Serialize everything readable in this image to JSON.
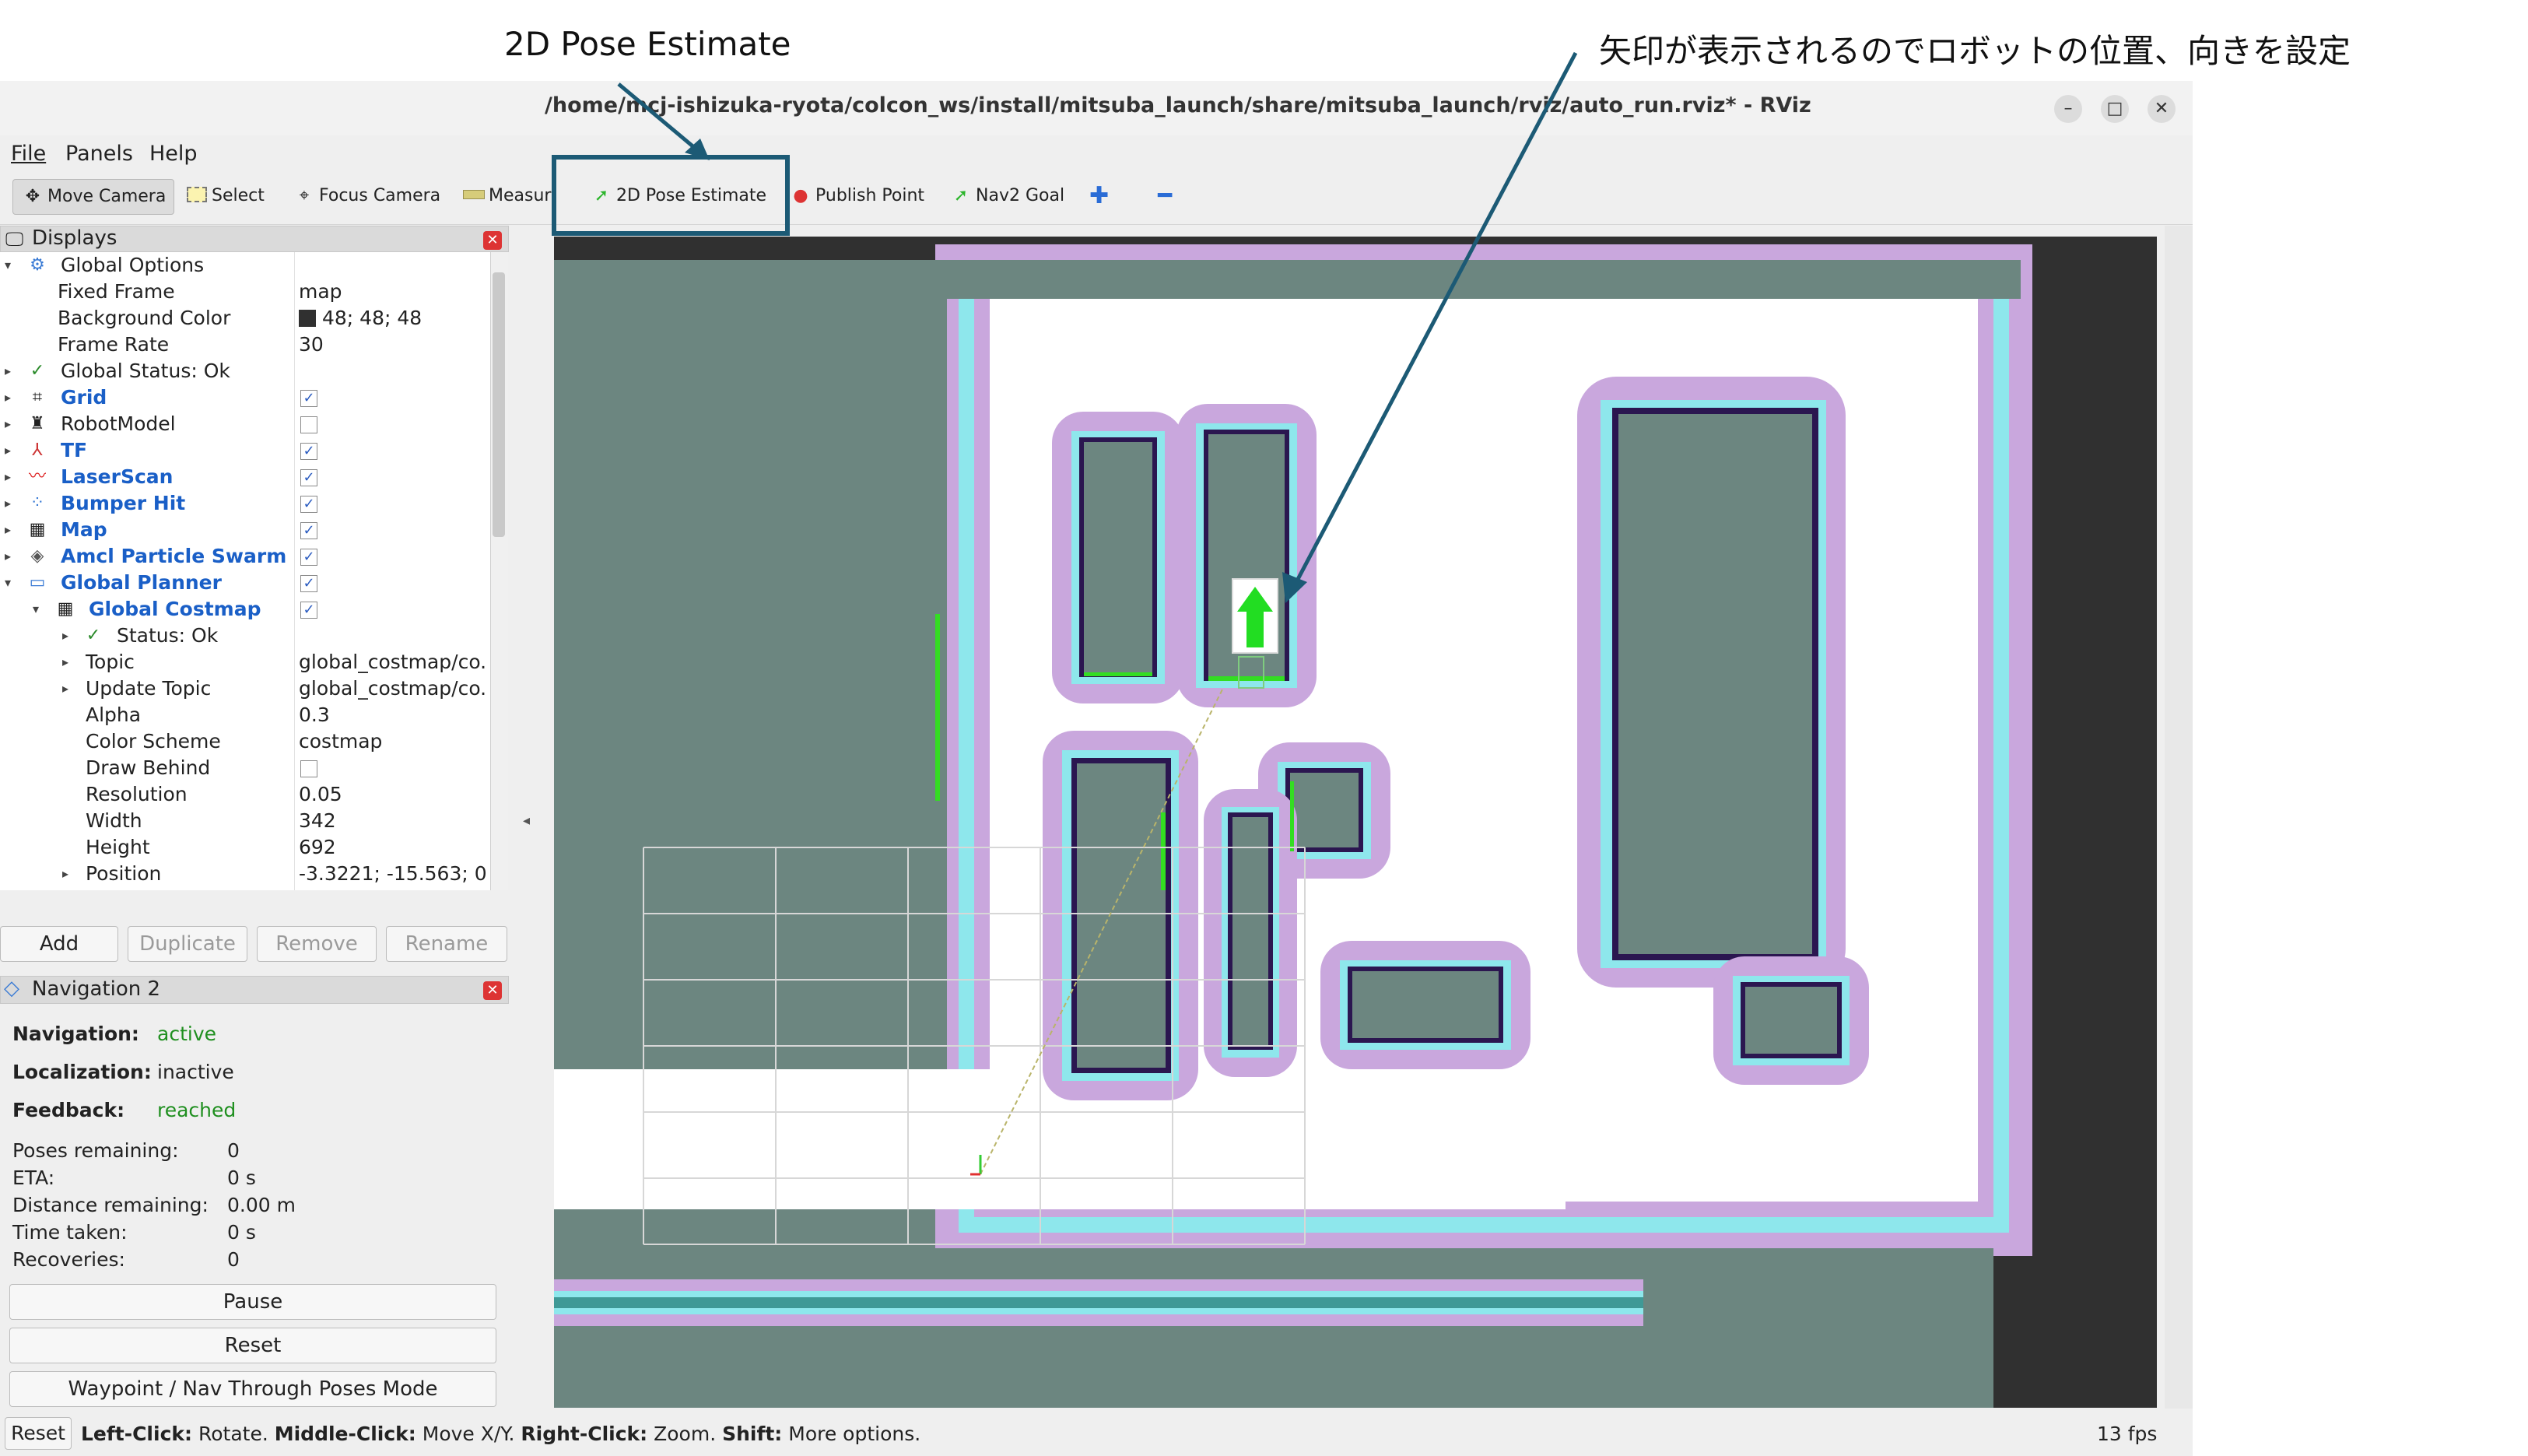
{
  "annotations": {
    "pose_label": "2D Pose Estimate",
    "arrow_note": "矢印が表示されるのでロボットの位置、向きを設定"
  },
  "window": {
    "title": "/home/mcj-ishizuka-ryota/colcon_ws/install/mitsuba_launch/share/mitsuba_launch/rviz/auto_run.rviz* - RViz",
    "controls": [
      "–",
      "□",
      "✕"
    ]
  },
  "menu": [
    "File",
    "Panels",
    "Help"
  ],
  "toolbar": {
    "move_camera": "Move Camera",
    "select": "Select",
    "focus_camera": "Focus Camera",
    "measure": "Measur",
    "pose_estimate": "2D Pose Estimate",
    "publish_point": "Publish Point",
    "nav2_goal": "Nav2 Goal",
    "icons": [
      "move-camera-icon",
      "select-icon",
      "focus-camera-icon",
      "measure-icon",
      "pose-arrow-icon",
      "pin-icon",
      "goal-arrow-icon",
      "plus-icon",
      "minus-icon"
    ]
  },
  "displays": {
    "title": "Displays",
    "rows": [
      {
        "label": "Global Options",
        "value": ""
      },
      {
        "label": "Fixed Frame",
        "value": "map"
      },
      {
        "label": "Background Color",
        "value": "48; 48; 48"
      },
      {
        "label": "Frame Rate",
        "value": "30"
      },
      {
        "label": "Global Status: Ok",
        "value": ""
      },
      {
        "label": "Grid",
        "value": "✓"
      },
      {
        "label": "RobotModel",
        "value": ""
      },
      {
        "label": "TF",
        "value": "✓"
      },
      {
        "label": "LaserScan",
        "value": "✓"
      },
      {
        "label": "Bumper Hit",
        "value": "✓"
      },
      {
        "label": "Map",
        "value": "✓"
      },
      {
        "label": "Amcl Particle Swarm",
        "value": "✓"
      },
      {
        "label": "Global Planner",
        "value": "✓"
      },
      {
        "label": "Global Costmap",
        "value": "✓"
      },
      {
        "label": "Status: Ok",
        "value": ""
      },
      {
        "label": "Topic",
        "value": "global_costmap/co."
      },
      {
        "label": "Update Topic",
        "value": "global_costmap/co."
      },
      {
        "label": "Alpha",
        "value": "0.3"
      },
      {
        "label": "Color Scheme",
        "value": "costmap"
      },
      {
        "label": "Draw Behind",
        "value": ""
      },
      {
        "label": "Resolution",
        "value": "0.05"
      },
      {
        "label": "Width",
        "value": "342"
      },
      {
        "label": "Height",
        "value": "692"
      },
      {
        "label": "Position",
        "value": "-3.3221; -15.563; 0"
      }
    ],
    "buttons": {
      "add": "Add",
      "duplicate": "Duplicate",
      "remove": "Remove",
      "rename": "Rename"
    }
  },
  "navigation": {
    "title": "Navigation 2",
    "navigation_label": "Navigation:",
    "navigation_value": "active",
    "localization_label": "Localization:",
    "localization_value": "inactive",
    "feedback_label": "Feedback:",
    "feedback_value": "reached",
    "poses_remaining_label": "Poses remaining:",
    "poses_remaining_value": "0",
    "eta_label": "ETA:",
    "eta_value": "0 s",
    "distance_label": "Distance remaining:",
    "distance_value": "0.00 m",
    "time_label": "Time taken:",
    "time_value": "0 s",
    "recoveries_label": "Recoveries:",
    "recoveries_value": "0",
    "pause": "Pause",
    "reset": "Reset",
    "waypoint": "Waypoint / Nav Through Poses Mode"
  },
  "status_bar": {
    "reset": "Reset",
    "hint_left_key": "Left-Click:",
    "hint_left": " Rotate. ",
    "hint_middle_key": "Middle-Click:",
    "hint_middle": " Move X/Y. ",
    "hint_right_key": "Right-Click:",
    "hint_right": " Zoom. ",
    "hint_shift_key": "Shift:",
    "hint_shift": " More options.",
    "fps": "13 fps"
  },
  "colors": {
    "highlight_box": "#1c5a75",
    "costmap_lilac": "#c9a7dd",
    "costmap_cyan": "#8ee7ec",
    "obstacle_teal": "#3f9996",
    "map_gray": "#6c8680",
    "lethal_navy": "#2b1650",
    "free_white": "#ffffff",
    "scan_green": "#33dd22",
    "viewport_bg": "#303030"
  }
}
